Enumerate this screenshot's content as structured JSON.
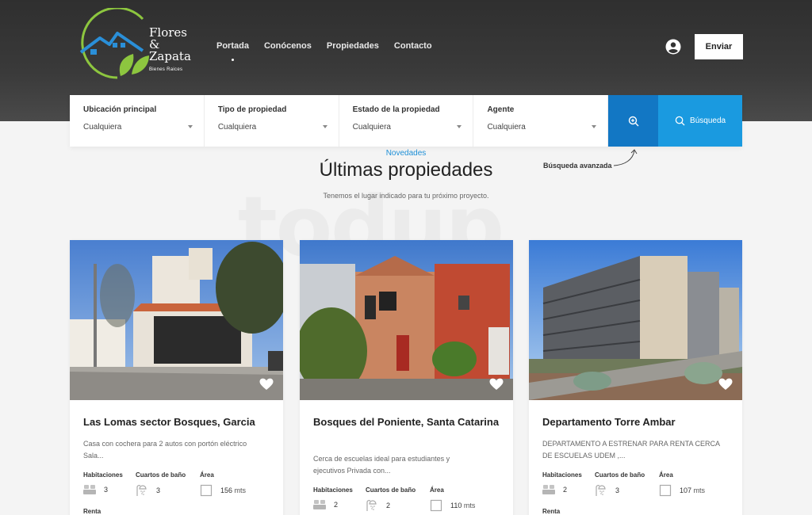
{
  "brand": {
    "line1": "Flores",
    "line2": "&",
    "line3": "Zapata",
    "tagline": "Bienes Raices"
  },
  "nav": [
    {
      "label": "Portada",
      "active": true
    },
    {
      "label": "Conócenos"
    },
    {
      "label": "Propiedades"
    },
    {
      "label": "Contacto"
    }
  ],
  "header": {
    "user_icon": "user-circle-icon",
    "send_label": "Enviar"
  },
  "search": {
    "fields": [
      {
        "label": "Ubicación principal",
        "value": "Cualquiera"
      },
      {
        "label": "Tipo de propiedad",
        "value": "Cualquiera"
      },
      {
        "label": "Estado de la propiedad",
        "value": "Cualquiera"
      },
      {
        "label": "Agente",
        "value": "Cualquiera"
      }
    ],
    "advanced_icon": "zoom-plus-icon",
    "search_label": "Búsqueda",
    "advanced_link": "Búsqueda avanzada"
  },
  "section": {
    "tag": "Novedades",
    "title": "Últimas propiedades",
    "subtitle": "Tenemos el lugar indicado para tu próximo proyecto.",
    "watermark": "todup"
  },
  "listings": [
    {
      "title": "Las Lomas sector Bosques, Garcia",
      "desc_1": "Casa con cochera para 2 autos con portón eléctrico",
      "desc_2": "Sala...",
      "hab_label": "Habitaciones",
      "hab": "3",
      "banos_label": "Cuartos de baño",
      "banos": "3",
      "area_label": "Área",
      "area": "156",
      "unit": "mts",
      "status": "Renta"
    },
    {
      "title": "Bosques del Poniente, Santa Catarina",
      "desc_1": "Cerca de escuelas ideal para estudiantes y",
      "desc_2": "ejecutivos Privada con...",
      "hab_label": "Habitaciones",
      "hab": "2",
      "banos_label": "Cuartos de baño",
      "banos": "2",
      "area_label": "Área",
      "area": "110",
      "unit": "mts"
    },
    {
      "title": "Departamento Torre Ambar",
      "desc_1": "DEPARTAMENTO A ESTRENAR PARA RENTA CERCA",
      "desc_2": "DE ESCUELAS UDEM ,...",
      "hab_label": "Habitaciones",
      "hab": "2",
      "banos_label": "Cuartos de baño",
      "banos": "3",
      "area_label": "Área",
      "area": "107",
      "unit": "mts",
      "status": "Renta"
    }
  ],
  "colors": {
    "accent": "#1a9ae0",
    "accent_dark": "#1277c4",
    "header_bg": "#2f2f2f",
    "logo_green": "#8dc63f",
    "logo_blue": "#2a8fd8"
  }
}
